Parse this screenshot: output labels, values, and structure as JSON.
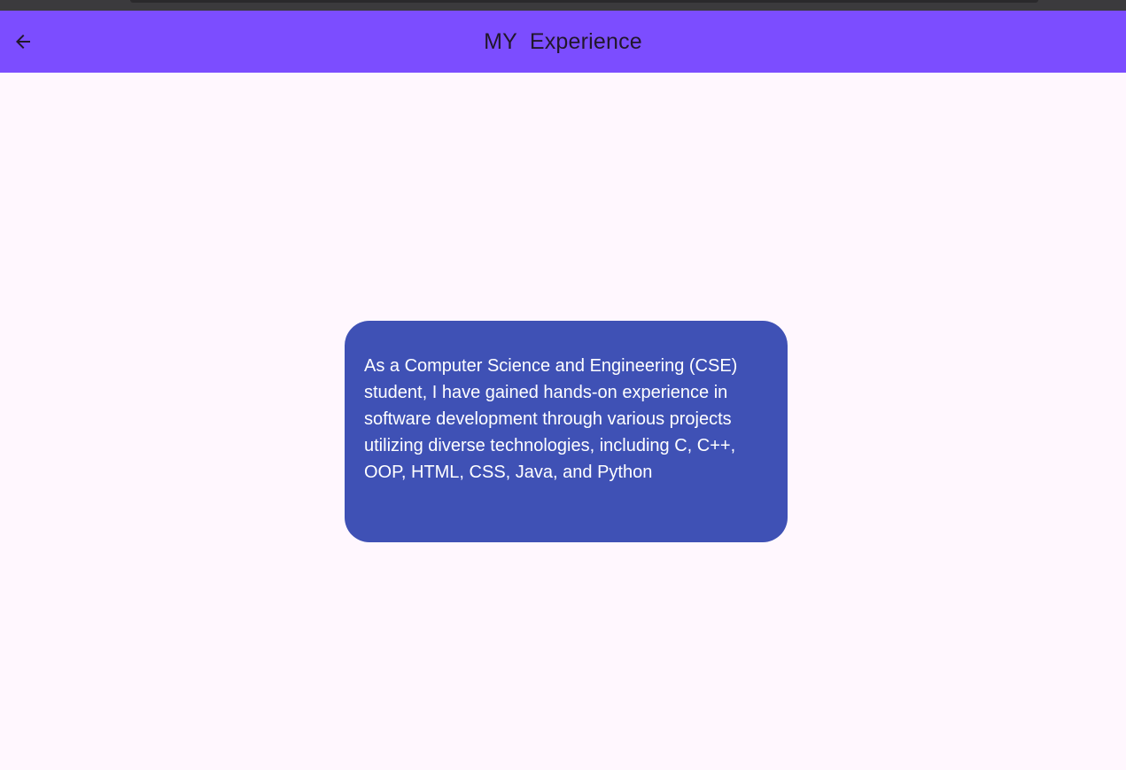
{
  "app_bar": {
    "title": "MY  Experience",
    "back_icon": "arrow-left-icon",
    "background": "#7c4dff"
  },
  "card": {
    "text": "As a Computer Science and Engineering (CSE) student, I have gained hands-on experience in software development through various projects utilizing diverse technologies, including C, C++, OOP, HTML, CSS, Java, and Python",
    "background": "#3f51b5",
    "text_color": "#ffffff"
  },
  "page": {
    "background": "#fff7fe"
  }
}
